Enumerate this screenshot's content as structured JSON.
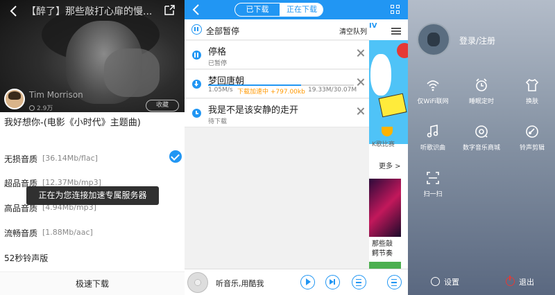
{
  "left": {
    "header_title": "【醉了】那些敲打心扉的慢...",
    "artist": "Tim Morrison",
    "fans": "2.9万",
    "collect_label": "收藏",
    "song_title": "我好想你-(电影《小时代》主题曲)",
    "qualities": [
      {
        "name": "无损音质",
        "spec": "[36.14Mb/flac]",
        "selected": true
      },
      {
        "name": "超品音质",
        "spec": "[12.37Mb/mp3]",
        "selected": false
      },
      {
        "name": "高品音质",
        "spec": "[4.94Mb/mp3]",
        "selected": false
      },
      {
        "name": "流畅音质",
        "spec": "[1.88Mb/aac]",
        "selected": false
      },
      {
        "name": "52秒铃声版",
        "spec": "",
        "selected": false
      }
    ],
    "toast": "正在为您连接加速专属服务器",
    "download_button": "极速下载"
  },
  "middle": {
    "tabs": [
      "已下载",
      "正在下载"
    ],
    "active_tab": 1,
    "pause_all": "全部暂停",
    "clear_queue": "清空队列",
    "downloads": [
      {
        "title": "停格",
        "status": "已暂停",
        "icon": "pause-icon"
      },
      {
        "title": "梦回唐朝",
        "speed": "1.05M/s",
        "boost": "下载加速中 +797.00kb",
        "size": "19.33M/30.07M",
        "progress": 0.64,
        "icon": "download-icon"
      },
      {
        "title": "我是不是该安静的走开",
        "status": "待下载",
        "icon": "clock-icon"
      }
    ],
    "strip": {
      "mv_text": "IV",
      "kge": "K歌比赛",
      "more": "更多 >",
      "promo": "那些敲\n鳄节奏"
    },
    "player_text": "听音乐,用酷我"
  },
  "right": {
    "login": "登录/注册",
    "features": [
      {
        "label": "仅WiFi联网",
        "icon": "wifi-icon"
      },
      {
        "label": "睡眠定时",
        "icon": "alarm-icon"
      },
      {
        "label": "换肤",
        "icon": "shirt-icon"
      },
      {
        "label": "听歌识曲",
        "icon": "music-note-icon"
      },
      {
        "label": "数字音乐商城",
        "icon": "shop-icon"
      },
      {
        "label": "铃声剪辑",
        "icon": "ringtone-icon"
      },
      {
        "label": "扫一扫",
        "icon": "scan-icon"
      }
    ],
    "settings": "设置",
    "exit": "退出"
  },
  "colors": {
    "accent": "#2196f3",
    "boost": "#ff9800",
    "exit": "#e53935"
  }
}
